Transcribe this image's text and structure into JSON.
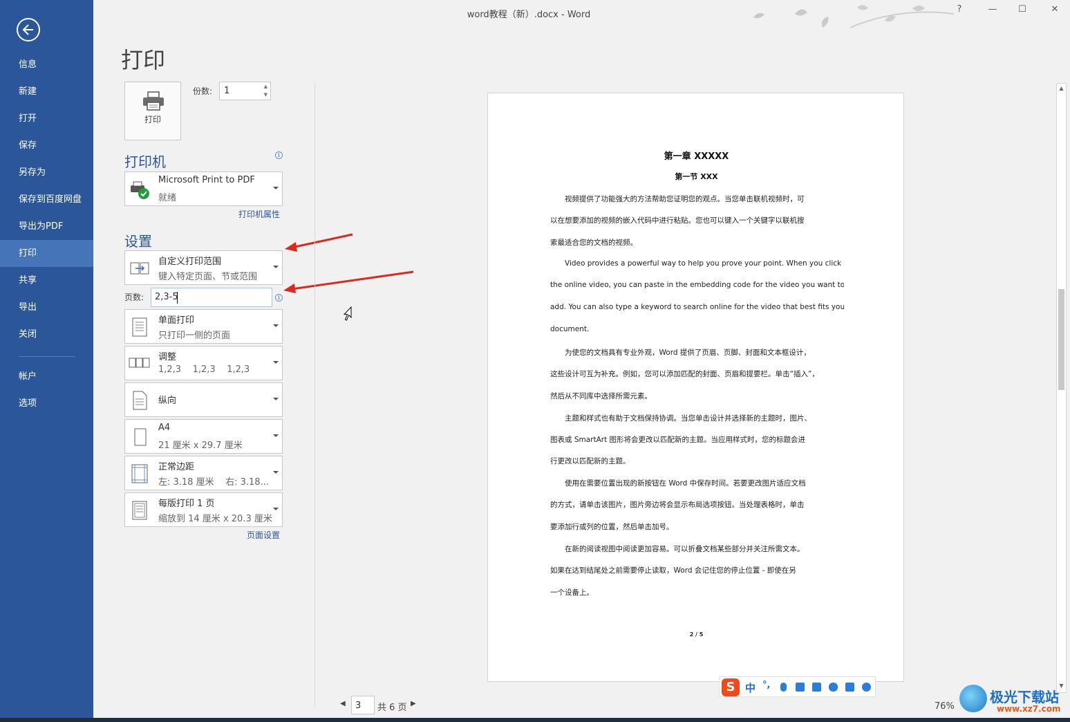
{
  "window": {
    "title": "word教程（新）.docx - Word",
    "help": "?",
    "minimize": "—",
    "maximize": "☐",
    "close": "✕"
  },
  "sidebar": {
    "items": [
      {
        "label": "信息"
      },
      {
        "label": "新建"
      },
      {
        "label": "打开"
      },
      {
        "label": "保存"
      },
      {
        "label": "另存为"
      },
      {
        "label": "保存到百度网盘"
      },
      {
        "label": "导出为PDF"
      },
      {
        "label": "打印",
        "active": true
      },
      {
        "label": "共享"
      },
      {
        "label": "导出"
      },
      {
        "label": "关闭"
      },
      {
        "label": "帐户"
      },
      {
        "label": "选项"
      }
    ]
  },
  "page_title": "打印",
  "print_button_label": "打印",
  "copies": {
    "label": "份数:",
    "value": "1"
  },
  "printer": {
    "heading": "打印机",
    "name": "Microsoft Print to PDF",
    "status": "就绪",
    "properties_link": "打印机属性"
  },
  "settings": {
    "heading": "设置",
    "range": {
      "title": "自定义打印范围",
      "sub": "键入特定页面、节或范围"
    },
    "pages": {
      "label": "页数:",
      "value": "2,3-5"
    },
    "sides": {
      "title": "单面打印",
      "sub": "只打印一侧的页面"
    },
    "collate": {
      "title": "调整",
      "sub": "1,2,3    1,2,3    1,2,3"
    },
    "orientation": {
      "title": "纵向"
    },
    "paper": {
      "title": "A4",
      "sub": "21 厘米 x 29.7 厘米"
    },
    "margins": {
      "title": "正常边距",
      "sub": "左: 3.18 厘米    右: 3.18..."
    },
    "per_sheet": {
      "title": "每版打印 1 页",
      "sub": "缩放到 14 厘米 x 20.3 厘米"
    },
    "page_setup_link": "页面设置"
  },
  "preview": {
    "heading1": "第一章  XXXXX",
    "heading2": "第一节  XXX",
    "lines": [
      "视频提供了功能强大的方法帮助您证明您的观点。当您单击联机视频时，可",
      "以在想要添加的视频的嵌入代码中进行粘贴。您也可以键入一个关键字以联机搜",
      "索最适合您的文档的视频。",
      "Video provides a powerful way to help you prove your point. When you click",
      "the online video, you can paste in the embedding code for the video you want to",
      "add. You can also type a keyword to search online for the video that best fits your",
      "document.",
      "为使您的文档具有专业外观，Word  提供了页眉、页脚、封面和文本框设计，",
      "这些设计可互为补充。例如，您可以添加匹配的封面、页眉和提要栏。单击“插入”，",
      "然后从不同库中选择所需元素。",
      "主题和样式也有助于文档保持协调。当您单击设计并选择新的主题时，图片、",
      "图表或  SmartArt  图形将会更改以匹配新的主题。当应用样式时，您的标题会进",
      "行更改以匹配新的主题。",
      "使用在需要位置出现的新按钮在  Word  中保存时间。若要更改图片适应文档",
      "的方式，请单击该图片，图片旁边将会显示布局选项按钮。当处理表格时，单击",
      "要添加行或列的位置，然后单击加号。",
      "在新的阅读视图中阅读更加容易。可以折叠文档某些部分并关注所需文本。",
      "如果在达到结尾处之前需要停止读取，Word  会记住您的停止位置  -  即使在另",
      "一个设备上。"
    ],
    "footer": "2 / 5"
  },
  "pager": {
    "current": "3",
    "total": "共 6 页"
  },
  "zoom": "76%",
  "ime": {
    "mode": "中",
    "punct": "°,"
  },
  "watermark": {
    "name": "极光下载站",
    "url": "www.xz7.com"
  }
}
